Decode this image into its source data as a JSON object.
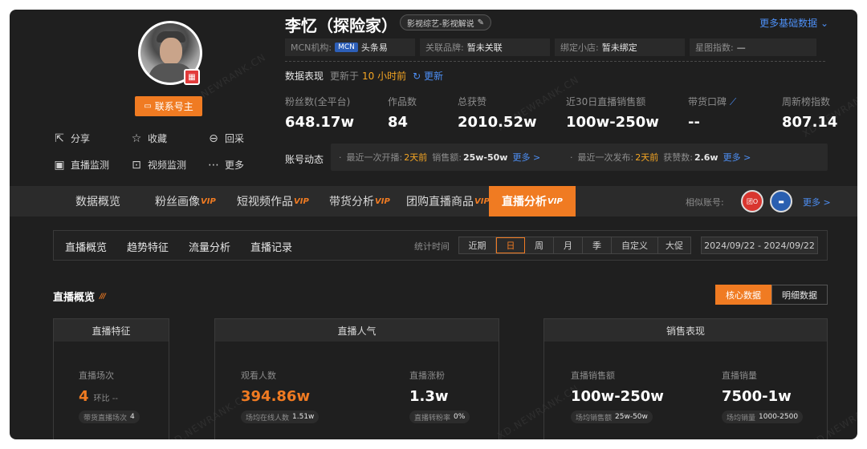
{
  "profile": {
    "name": "李忆（探险家）",
    "tag": "影视综艺-影视解说",
    "contact_label": "联系号主",
    "actions": [
      {
        "icon": "share-icon",
        "label": "分享"
      },
      {
        "icon": "star-icon",
        "label": "收藏"
      },
      {
        "icon": "collect-icon",
        "label": "回采"
      },
      {
        "icon": "live-monitor-icon",
        "label": "直播监测"
      },
      {
        "icon": "video-monitor-icon",
        "label": "视频监测"
      },
      {
        "icon": "more-icon",
        "label": "更多"
      }
    ],
    "more_basic": "更多基础数据"
  },
  "info": {
    "mcn_label": "MCN机构:",
    "mcn_badge": "MCN",
    "mcn_value": "头条易",
    "brand_label": "关联品牌:",
    "brand_value": "暂未关联",
    "shop_label": "绑定小店:",
    "shop_value": "暂未绑定",
    "star_label": "星图指数:",
    "star_value": "—"
  },
  "performance": {
    "title": "数据表现",
    "updated_prefix": "更新于",
    "updated_time": "10 小时前",
    "update_label": "更新"
  },
  "stats": [
    {
      "label": "粉丝数(全平台)",
      "value": "648.17w"
    },
    {
      "label": "作品数",
      "value": "84"
    },
    {
      "label": "总获赞",
      "value": "2010.52w"
    },
    {
      "label": "近30日直播销售额",
      "value": "100w-250w"
    },
    {
      "label": "带货口碑",
      "value": "--"
    },
    {
      "label": "周新榜指数",
      "value": "807.14"
    }
  ],
  "dynamics": {
    "label": "账号动态",
    "live_prefix": "最近一次开播:",
    "live_time": "2天前",
    "sales_label": "销售额:",
    "sales_value": "25w-50w",
    "more1": "更多 >",
    "post_prefix": "最近一次发布:",
    "post_time": "2天前",
    "likes_label": "获赞数:",
    "likes_value": "2.6w",
    "more2": "更多 >"
  },
  "main_tabs": [
    {
      "label": "数据概览",
      "vip": ""
    },
    {
      "label": "粉丝画像",
      "vip": "VIP"
    },
    {
      "label": "短视频作品",
      "vip": "VIP"
    },
    {
      "label": "带货分析",
      "vip": "VIP"
    },
    {
      "label": "团购直播商品",
      "vip": "VIP"
    },
    {
      "label": "直播分析",
      "vip": "VIP"
    }
  ],
  "similar": {
    "label": "相似账号:",
    "avatar1_text": "团O",
    "more": "更多 >"
  },
  "sub_tabs": [
    "直播概览",
    "趋势特征",
    "流量分析",
    "直播记录"
  ],
  "time_filter": {
    "label": "统计时间",
    "options": [
      "近期",
      "日",
      "周",
      "月",
      "季",
      "自定义",
      "大促"
    ],
    "selected": "日",
    "date_range": "2024/09/22 - 2024/09/22"
  },
  "section": {
    "title": "直播概览",
    "btn_core": "核心数据",
    "btn_detail": "明细数据"
  },
  "panels": {
    "features": {
      "title": "直播特征",
      "m1_label": "直播场次",
      "m1_value": "4",
      "m1_change": "环比 --",
      "m1_pill_label": "带货直播场次",
      "m1_pill_value": "4"
    },
    "popularity": {
      "title": "直播人气",
      "m1_label": "观看人数",
      "m1_value": "394.86w",
      "m1_pill_label": "场均在线人数",
      "m1_pill_value": "1.51w",
      "m2_label": "直播涨粉",
      "m2_value": "1.3w",
      "m2_pill_label": "直播转粉率",
      "m2_pill_value": "0%"
    },
    "sales": {
      "title": "销售表现",
      "m1_label": "直播销售额",
      "m1_value": "100w-250w",
      "m1_pill_label": "场均销售额",
      "m1_pill_value": "25w-50w",
      "m2_label": "直播销量",
      "m2_value": "7500-1w",
      "m2_pill_label": "场均销量",
      "m2_pill_value": "1000-2500"
    }
  },
  "watermark": "XD.NEWRANK.CN",
  "colors": {
    "accent": "#f07b22",
    "link": "#4d8ff5",
    "highlight": "#f5a623",
    "background": "#1f1f1f"
  }
}
